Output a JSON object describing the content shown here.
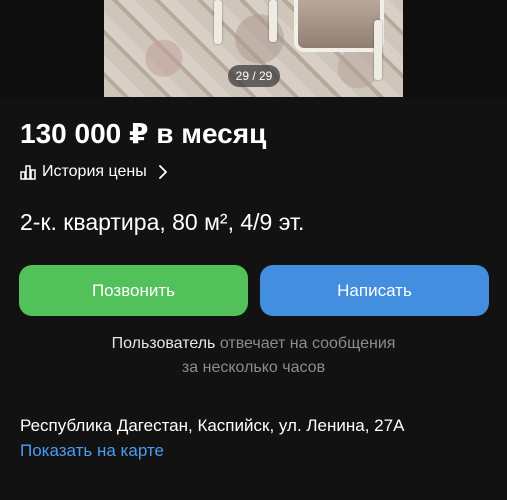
{
  "gallery": {
    "counter": "29 / 29"
  },
  "listing": {
    "price": "130 000 ₽ в месяц",
    "price_history_label": "История цены",
    "title": "2-к. квартира, 80 м², 4/9 эт."
  },
  "actions": {
    "call_label": "Позвонить",
    "write_label": "Написать"
  },
  "seller": {
    "name": "Пользователь",
    "reply_text_line1": " отвечает на сообщения",
    "reply_text_line2": "за несколько часов"
  },
  "location": {
    "address": "Республика Дагестан, Каспийск, ул. Ленина, 27А",
    "map_link": "Показать на карте"
  },
  "colors": {
    "background": "#121212",
    "call_button": "#52c15a",
    "write_button": "#438edf",
    "link": "#4b9cf0",
    "muted_text": "#8c8c8c"
  },
  "icons": {
    "price_history": "bar-chart-icon",
    "price_history_arrow": "chevron-right-icon"
  }
}
